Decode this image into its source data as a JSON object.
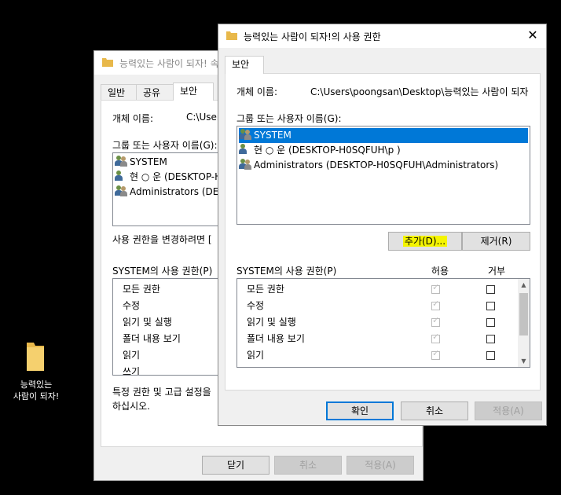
{
  "desktop": {
    "icon_label_line1": "능력있는",
    "icon_label_line2": "사람이 되자!"
  },
  "back_window": {
    "title": "능력있는 사람이 되자! 속",
    "tabs": [
      "일반",
      "공유",
      "보안"
    ],
    "object_name_label": "개체 이름:",
    "object_name_value": "C:\\User",
    "group_label": "그룹 또는 사용자 이름(G):",
    "users": [
      "SYSTEM",
      "현 ○ 운 (DESKTOP-H",
      "Administrators (DES"
    ],
    "change_perm_text": "사용 권한을 변경하려면 [",
    "perm_label": "SYSTEM의 사용 권한(P)",
    "permissions": [
      "모든 권한",
      "수정",
      "읽기 및 실행",
      "폴더 내용 보기",
      "읽기",
      "쓰기"
    ],
    "special_text_1": "특정 권한 및 고급 설정을",
    "special_text_2": "하십시오.",
    "buttons": {
      "close": "닫기",
      "cancel": "취소",
      "apply": "적용(A)"
    }
  },
  "front_window": {
    "title": "능력있는 사람이 되자!의 사용 권한",
    "close_glyph": "✕",
    "tab": "보안",
    "object_name_label": "개체 이름:",
    "object_name_value": "C:\\Users\\poongsan\\Desktop\\능력있는 사람이 되자",
    "group_label": "그룹 또는 사용자 이름(G):",
    "users": [
      {
        "name": "SYSTEM",
        "selected": true
      },
      {
        "name": "현 ○ 운 (DESKTOP-H0SQFUH\\p       )",
        "selected": false
      },
      {
        "name": "Administrators (DESKTOP-H0SQFUH\\Administrators)",
        "selected": false
      }
    ],
    "add_button": "추가(D)...",
    "remove_button": "제거(R)",
    "perm_label": "SYSTEM의 사용 권한(P)",
    "allow_header": "허용",
    "deny_header": "거부",
    "permissions": [
      "모든 권한",
      "수정",
      "읽기 및 실행",
      "폴더 내용 보기",
      "읽기"
    ],
    "buttons": {
      "ok": "확인",
      "cancel": "취소",
      "apply": "적용(A)"
    }
  }
}
